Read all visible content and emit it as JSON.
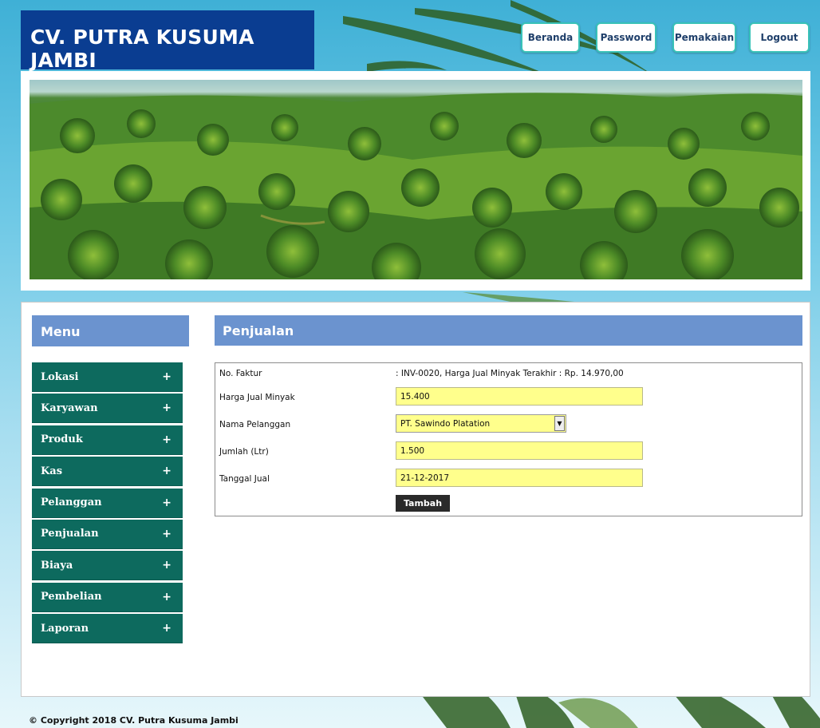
{
  "header": {
    "site_title": "CV. PUTRA KUSUMA JAMBI",
    "nav": [
      {
        "label": "Beranda"
      },
      {
        "label": "Password"
      },
      {
        "label": "Pemakaian"
      },
      {
        "label": "Logout"
      }
    ]
  },
  "banner": {
    "description_icon": "palm-plantation-banner"
  },
  "sidebar": {
    "title": "Menu",
    "items": [
      {
        "label": "Lokasi",
        "icon": "+"
      },
      {
        "label": "Karyawan",
        "icon": "+"
      },
      {
        "label": "Produk",
        "icon": "+"
      },
      {
        "label": "Kas",
        "icon": "+"
      },
      {
        "label": "Pelanggan",
        "icon": "+"
      },
      {
        "label": "Penjualan",
        "icon": "+"
      },
      {
        "label": "Biaya",
        "icon": "+"
      },
      {
        "label": "Pembelian",
        "icon": "+"
      },
      {
        "label": "Laporan",
        "icon": "+"
      }
    ]
  },
  "main": {
    "title": "Penjualan",
    "form": {
      "no_faktur_label": "No. Faktur",
      "no_faktur_value": ": INV-0020, Harga Jual Minyak Terakhir : Rp. 14.970,00",
      "harga_label": "Harga Jual Minyak",
      "harga_value": "15.400",
      "pelanggan_label": "Nama Pelanggan",
      "pelanggan_value": "PT. Sawindo Platation",
      "jumlah_label": "Jumlah (Ltr)",
      "jumlah_value": "1.500",
      "tanggal_label": "Tanggal Jual",
      "tanggal_value": "21-12-2017",
      "submit_label": "Tambah"
    }
  },
  "footer": {
    "copyright": "© Copyright 2018 CV. Putra Kusuma Jambi"
  },
  "colors": {
    "title_bg": "#0a3d91",
    "header_bar": "#6b93cf",
    "menu_item": "#0d6a5e",
    "input_bg": "#ffff8c",
    "button": "#2a2a2a"
  }
}
